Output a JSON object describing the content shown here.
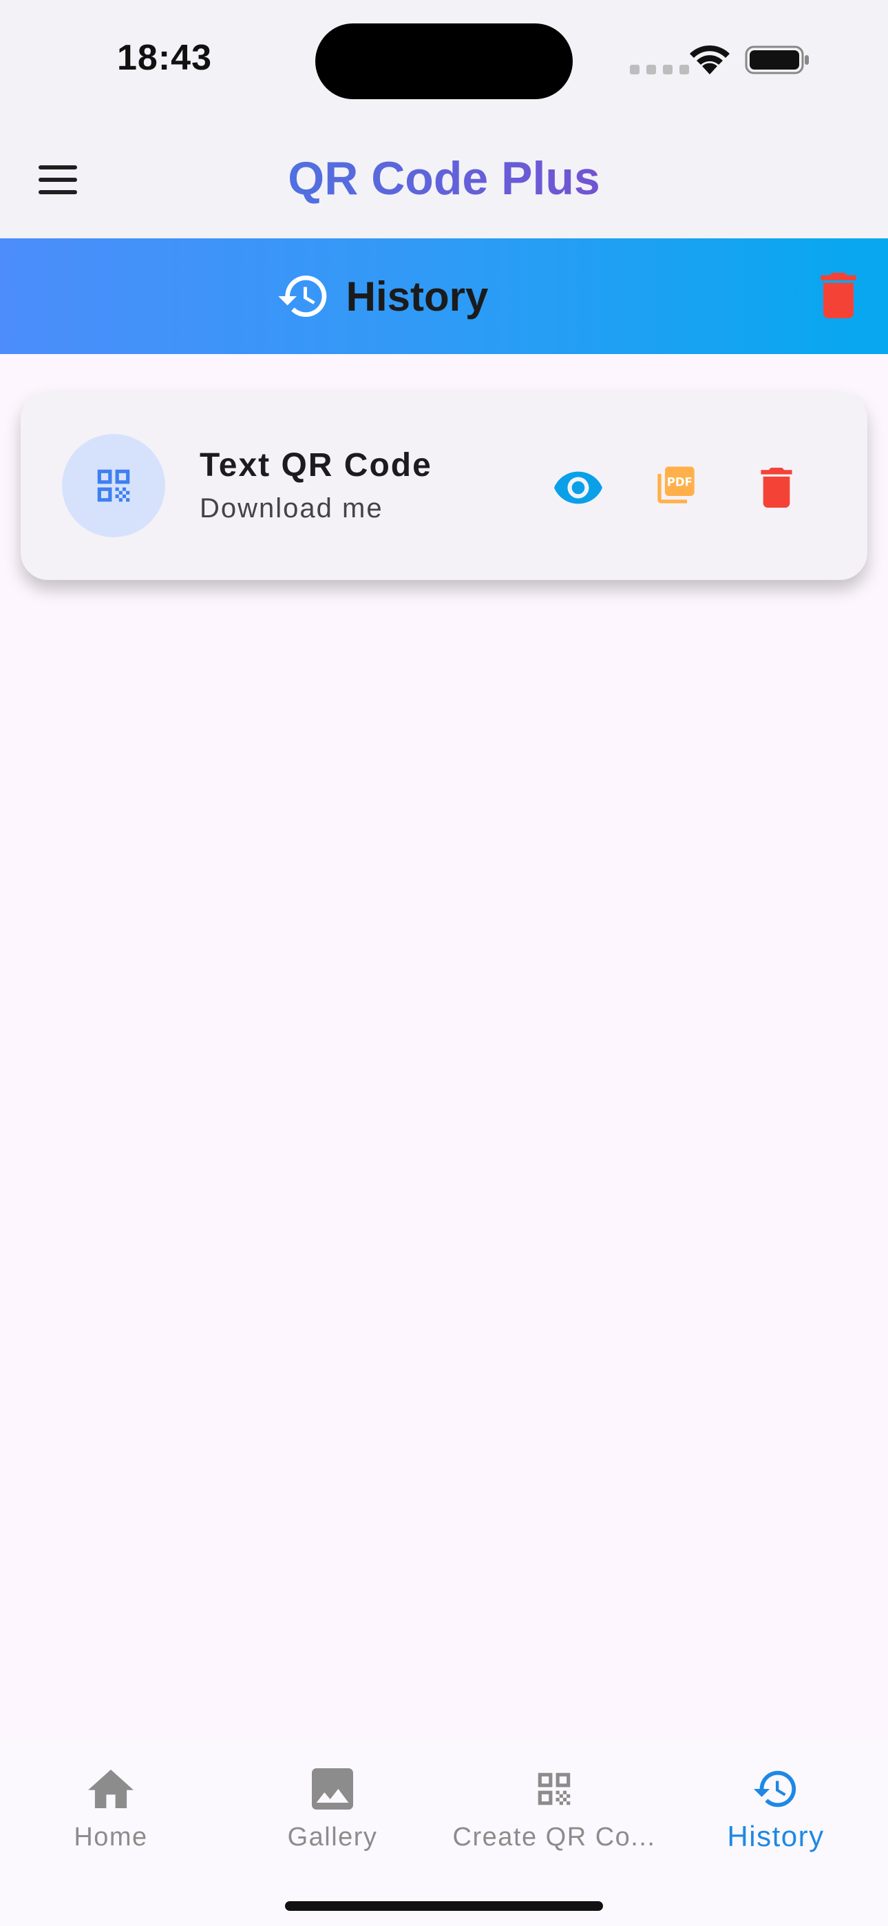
{
  "status_bar": {
    "time": "18:43"
  },
  "app_bar": {
    "title": "QR Code Plus"
  },
  "banner": {
    "title": "History"
  },
  "history_items": [
    {
      "title": "Text QR Code",
      "subtitle": "Download me",
      "icon": "qr-code-icon",
      "actions": [
        "eye-icon",
        "pdf-icon",
        "trash-icon"
      ]
    }
  ],
  "bottom_nav": {
    "items": [
      {
        "label": "Home",
        "icon": "home-icon",
        "active": false
      },
      {
        "label": "Gallery",
        "icon": "image-icon",
        "active": false
      },
      {
        "label": "Create QR Co...",
        "icon": "qr-code-icon",
        "active": false
      },
      {
        "label": "History",
        "icon": "history-icon",
        "active": true
      }
    ]
  },
  "colors": {
    "brand_blue": "#1E88E5",
    "banner_start": "#4C8DFB",
    "banner_end": "#06A8EF",
    "delete_red": "#F44336",
    "pdf_orange": "#FFB04A",
    "view_blue": "#0AA0E8",
    "inactive_gray": "#8C8C8C"
  }
}
